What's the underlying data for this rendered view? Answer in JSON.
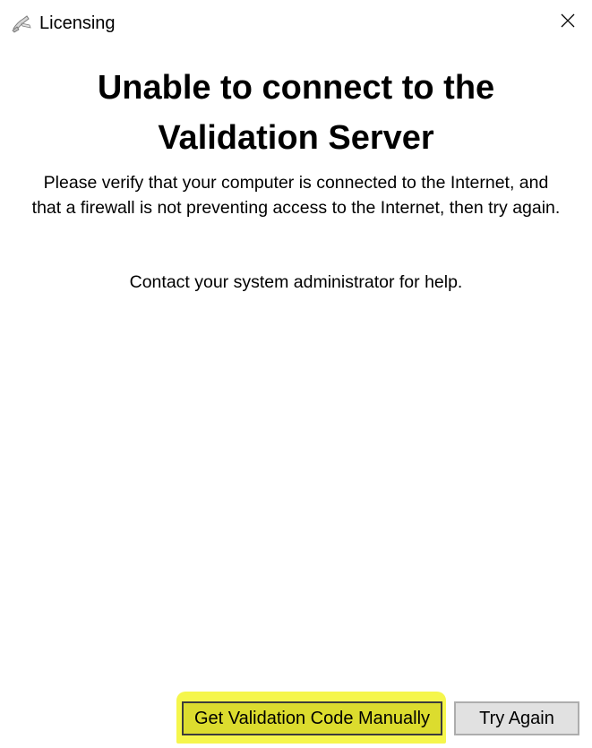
{
  "window": {
    "title": "Licensing",
    "app_icon": "licensing-app-icon",
    "close_icon": "close-icon"
  },
  "dialog": {
    "heading_line1": "Unable to connect to the",
    "heading_line2": "Validation Server",
    "message": "Please verify that your computer is connected to the Internet, and that a firewall is not preventing access to the Internet, then try again.",
    "contact": "Contact your system administrator for help."
  },
  "buttons": {
    "manual_label": "Get Validation Code Manually",
    "try_again_label": "Try Again"
  },
  "colors": {
    "highlight": "#f4f538",
    "button_face": "#e1e1e1"
  }
}
